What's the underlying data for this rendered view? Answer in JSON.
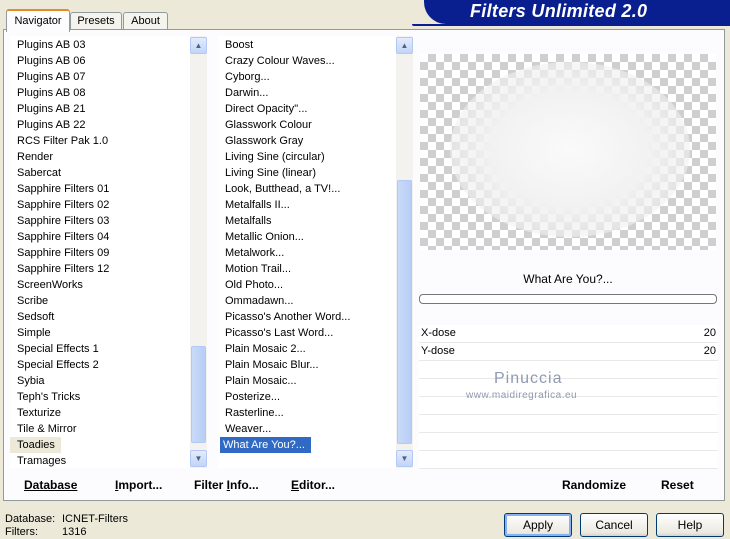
{
  "app": {
    "title": "Filters Unlimited 2.0"
  },
  "tabs": [
    {
      "label": "Navigator",
      "active": true
    },
    {
      "label": "Presets",
      "active": false
    },
    {
      "label": "About",
      "active": false
    }
  ],
  "categories": {
    "items": [
      "Plugins AB 03",
      "Plugins AB 06",
      "Plugins AB 07",
      "Plugins AB 08",
      "Plugins AB 21",
      "Plugins AB 22",
      "RCS Filter Pak 1.0",
      "Render",
      "Sabercat",
      "Sapphire Filters 01",
      "Sapphire Filters 02",
      "Sapphire Filters 03",
      "Sapphire Filters 04",
      "Sapphire Filters 09",
      "Sapphire Filters 12",
      "ScreenWorks",
      "Scribe",
      "Sedsoft",
      "Simple",
      "Special Effects 1",
      "Special Effects 2",
      "Sybia",
      "Teph's Tricks",
      "Texturize",
      "Tile & Mirror",
      "Toadies",
      "Tramages"
    ],
    "selected": "Toadies"
  },
  "filters": {
    "items": [
      "Boost",
      "Crazy Colour Waves...",
      "Cyborg...",
      "Darwin...",
      "Direct Opacity''...",
      "Glasswork Colour",
      "Glasswork Gray",
      "Living Sine (circular)",
      "Living Sine (linear)",
      "Look, Butthead, a TV!...",
      "Metalfalls II...",
      "Metalfalls",
      "Metallic Onion...",
      "Metalwork...",
      "Motion Trail...",
      "Old Photo...",
      "Ommadawn...",
      "Picasso's Another Word...",
      "Picasso's Last Word...",
      "Plain Mosaic 2...",
      "Plain Mosaic Blur...",
      "Plain Mosaic...",
      "Posterize...",
      "Rasterline...",
      "Weaver...",
      "What Are You?..."
    ],
    "selected": "What Are You?..."
  },
  "preview": {
    "filter_name": "What Are You?..."
  },
  "params": [
    {
      "label": "X-dose",
      "value": "20"
    },
    {
      "label": "Y-dose",
      "value": "20"
    }
  ],
  "watermark": {
    "line1": "Pinuccia",
    "line2": "www.maidiregrafica.eu"
  },
  "toolbar": {
    "database": "Database",
    "database_key": "D",
    "import": "mport...",
    "import_key": "I",
    "filter_info": "Filter ",
    "filter_info_key": "I",
    "filter_info_rest": "nfo...",
    "editor": "ditor...",
    "editor_key": "E",
    "randomize": "Randomize",
    "reset": "Reset"
  },
  "status": {
    "database_label": "Database:",
    "database_value": "ICNET-Filters",
    "filters_label": "Filters:",
    "filters_value": "1316"
  },
  "buttons": {
    "apply": "Apply",
    "cancel": "Cancel",
    "help": "Help"
  },
  "colors": {
    "banner": "#0a1f8f",
    "selection": "#316ac5",
    "highlight": "#ece9d8"
  }
}
